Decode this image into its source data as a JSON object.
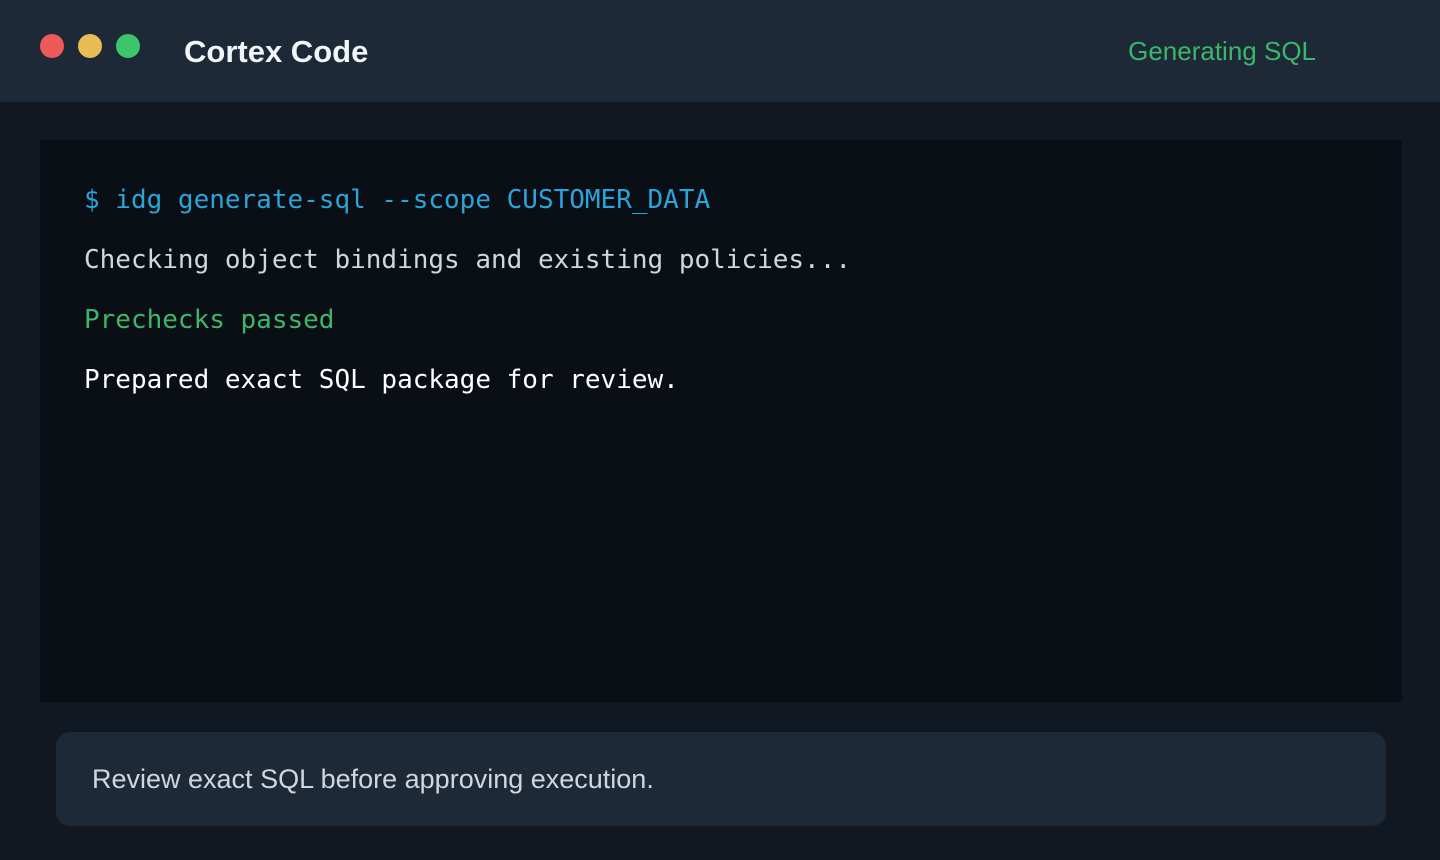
{
  "window": {
    "title": "Cortex Code",
    "status": "Generating SQL",
    "controls": {
      "close_color": "#ee5a5a",
      "minimize_color": "#e8bd55",
      "maximize_color": "#3ec46a"
    }
  },
  "terminal": {
    "lines": [
      {
        "text": "$ idg generate-sql --scope CUSTOMER_DATA",
        "color": "#2aa4d9"
      },
      {
        "text": "Checking object bindings and existing policies...",
        "color": "#d2d7de"
      },
      {
        "text": "Prechecks passed",
        "color": "#3cb66b"
      },
      {
        "text": "Prepared exact SQL package for review.",
        "color": "#ffffff"
      }
    ]
  },
  "footer": {
    "message": "Review exact SQL before approving execution."
  },
  "colors": {
    "status": "#3cb66b",
    "titlebar_bg": "#1d2937",
    "terminal_bg": "#0a0e15",
    "window_bg": "#111821"
  }
}
